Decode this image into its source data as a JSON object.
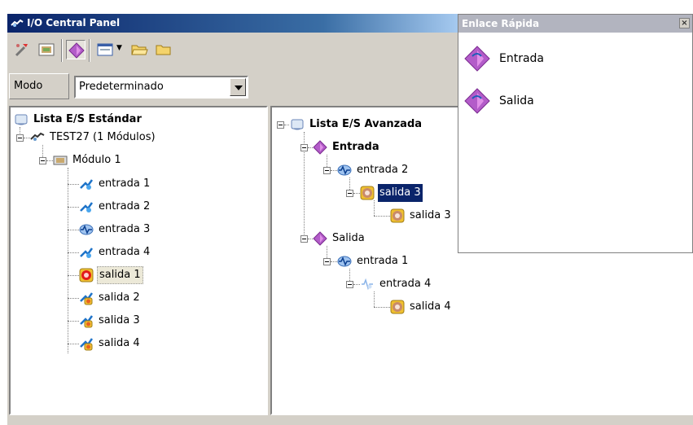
{
  "window": {
    "title": "I/O Central Panel"
  },
  "toolbar": {
    "buttons": [
      {
        "icon": "settings-wand-icon"
      },
      {
        "icon": "module-card-icon"
      },
      {
        "icon": "io-diamond-icon",
        "pressed": true
      },
      {
        "icon": "window-dropdown-icon"
      },
      {
        "icon": "folder-open-icon"
      },
      {
        "icon": "folder-icon"
      }
    ]
  },
  "mode": {
    "label": "Modo",
    "value": "Predeterminado"
  },
  "left_tree": {
    "root": "Lista E/S Estándar",
    "device": "TEST27 (1 Módulos)",
    "module": "Módulo 1",
    "items": [
      "entrada 1",
      "entrada 2",
      "entrada 3",
      "entrada 4",
      "salida 1",
      "salida 2",
      "salida 3",
      "salida 4"
    ]
  },
  "right_tree": {
    "root": "Lista E/S Avanzada",
    "entrada_group": "Entrada",
    "entrada_child": "entrada 2",
    "entrada_grandchild": "salida 3",
    "entrada_leaf": "salida 3",
    "salida_group": "Salida",
    "salida_child": "entrada 1",
    "salida_grandchild": "entrada 4",
    "salida_leaf": "salida 4"
  },
  "quick_link": {
    "title": "Enlace Rápida",
    "close": "×",
    "items": [
      "Entrada",
      "Salida"
    ]
  },
  "colors": {
    "selection": "#0a246a",
    "title_bar": "#0a246a",
    "face": "#d4d0c8"
  }
}
